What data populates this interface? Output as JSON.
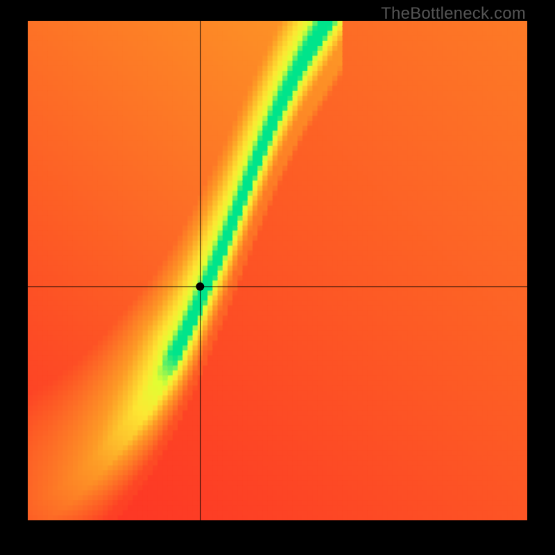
{
  "watermark": "TheBottleneck.com",
  "chart_data": {
    "type": "heatmap",
    "title": "",
    "xlabel": "",
    "ylabel": "",
    "xlim": [
      0,
      1
    ],
    "ylim": [
      0,
      1
    ],
    "colorscale": {
      "low": "#fe2a25",
      "mid_low": "#fd9c27",
      "mid": "#fee733",
      "mid_high": "#e0ff33",
      "high": "#00e48b"
    },
    "optimal_curve_points": [
      {
        "x": 0.0,
        "y": 0.0
      },
      {
        "x": 0.05,
        "y": 0.03
      },
      {
        "x": 0.1,
        "y": 0.07
      },
      {
        "x": 0.15,
        "y": 0.12
      },
      {
        "x": 0.2,
        "y": 0.18
      },
      {
        "x": 0.25,
        "y": 0.25
      },
      {
        "x": 0.3,
        "y": 0.34
      },
      {
        "x": 0.35,
        "y": 0.45
      },
      {
        "x": 0.4,
        "y": 0.57
      },
      {
        "x": 0.45,
        "y": 0.7
      },
      {
        "x": 0.5,
        "y": 0.82
      },
      {
        "x": 0.55,
        "y": 0.92
      },
      {
        "x": 0.6,
        "y": 1.0
      }
    ],
    "crosshair": {
      "x": 0.345,
      "y": 0.468
    },
    "marker": {
      "x": 0.345,
      "y": 0.468,
      "radius_px": 6
    },
    "curve_band_width_norm": 0.045,
    "grid_cells": 100
  }
}
